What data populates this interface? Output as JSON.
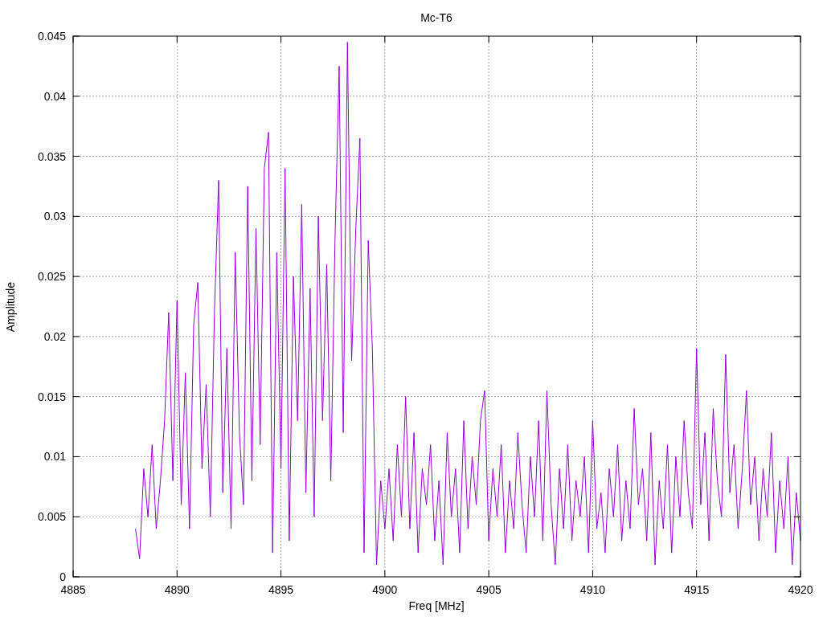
{
  "chart_data": {
    "type": "line",
    "title": "Mc-T6",
    "xlabel": "Freq [MHz]",
    "ylabel": "Amplitude",
    "xlim": [
      4885,
      4920
    ],
    "ylim": [
      0,
      0.045
    ],
    "grid": true,
    "xticks": [
      4885,
      4890,
      4895,
      4900,
      4905,
      4910,
      4915,
      4920
    ],
    "yticks": [
      0,
      0.005,
      0.01,
      0.015,
      0.02,
      0.025,
      0.03,
      0.035,
      0.04,
      0.045
    ],
    "x": [
      4888.0,
      4888.2,
      4888.4,
      4888.6,
      4888.8,
      4889.0,
      4889.2,
      4889.4,
      4889.6,
      4889.8,
      4890.0,
      4890.2,
      4890.4,
      4890.6,
      4890.8,
      4891.0,
      4891.2,
      4891.4,
      4891.6,
      4891.8,
      4892.0,
      4892.2,
      4892.4,
      4892.6,
      4892.8,
      4893.0,
      4893.2,
      4893.4,
      4893.6,
      4893.8,
      4894.0,
      4894.2,
      4894.4,
      4894.6,
      4894.8,
      4895.0,
      4895.2,
      4895.4,
      4895.6,
      4895.8,
      4896.0,
      4896.2,
      4896.4,
      4896.6,
      4896.8,
      4897.0,
      4897.2,
      4897.4,
      4897.6,
      4897.8,
      4898.0,
      4898.2,
      4898.4,
      4898.6,
      4898.8,
      4899.0,
      4899.2,
      4899.4,
      4899.6,
      4899.8,
      4900.0,
      4900.2,
      4900.4,
      4900.6,
      4900.8,
      4901.0,
      4901.2,
      4901.4,
      4901.6,
      4901.8,
      4902.0,
      4902.2,
      4902.4,
      4902.6,
      4902.8,
      4903.0,
      4903.2,
      4903.4,
      4903.6,
      4903.8,
      4904.0,
      4904.2,
      4904.4,
      4904.6,
      4904.8,
      4905.0,
      4905.2,
      4905.4,
      4905.6,
      4905.8,
      4906.0,
      4906.2,
      4906.4,
      4906.6,
      4906.8,
      4907.0,
      4907.2,
      4907.4,
      4907.6,
      4907.8,
      4908.0,
      4908.2,
      4908.4,
      4908.6,
      4908.8,
      4909.0,
      4909.2,
      4909.4,
      4909.6,
      4909.8,
      4910.0,
      4910.2,
      4910.4,
      4910.6,
      4910.8,
      4911.0,
      4911.2,
      4911.4,
      4911.6,
      4911.8,
      4912.0,
      4912.2,
      4912.4,
      4912.6,
      4912.8,
      4913.0,
      4913.2,
      4913.4,
      4913.6,
      4913.8,
      4914.0,
      4914.2,
      4914.4,
      4914.6,
      4914.8,
      4915.0,
      4915.2,
      4915.4,
      4915.6,
      4915.8,
      4916.0,
      4916.2,
      4916.4,
      4916.6,
      4916.8,
      4917.0,
      4917.2,
      4917.4,
      4917.6,
      4917.8,
      4918.0,
      4918.2,
      4918.4,
      4918.6,
      4918.8,
      4919.0,
      4919.2,
      4919.4,
      4919.6,
      4919.8,
      4920.0
    ],
    "series": [
      {
        "color": "#9400d3",
        "values": [
          0.004,
          0.0015,
          0.009,
          0.005,
          0.011,
          0.004,
          0.008,
          0.013,
          0.022,
          0.008,
          0.023,
          0.006,
          0.017,
          0.004,
          0.021,
          0.0245,
          0.009,
          0.016,
          0.005,
          0.022,
          0.033,
          0.007,
          0.019,
          0.004,
          0.027,
          0.012,
          0.006,
          0.0325,
          0.008,
          0.029,
          0.011,
          0.034,
          0.037,
          0.002,
          0.027,
          0.009,
          0.034,
          0.003,
          0.025,
          0.013,
          0.031,
          0.007,
          0.024,
          0.005,
          0.03,
          0.013,
          0.026,
          0.008,
          0.028,
          0.0425,
          0.012,
          0.0445,
          0.018,
          0.029,
          0.0365,
          0.002,
          0.028,
          0.019,
          0.001,
          0.008,
          0.004,
          0.009,
          0.003,
          0.011,
          0.005,
          0.015,
          0.004,
          0.012,
          0.002,
          0.009,
          0.006,
          0.011,
          0.003,
          0.008,
          0.001,
          0.012,
          0.005,
          0.009,
          0.002,
          0.013,
          0.004,
          0.01,
          0.006,
          0.013,
          0.0155,
          0.003,
          0.009,
          0.005,
          0.011,
          0.002,
          0.008,
          0.004,
          0.012,
          0.006,
          0.002,
          0.01,
          0.005,
          0.013,
          0.003,
          0.0155,
          0.006,
          0.001,
          0.009,
          0.004,
          0.011,
          0.003,
          0.008,
          0.005,
          0.01,
          0.002,
          0.013,
          0.004,
          0.007,
          0.002,
          0.009,
          0.005,
          0.011,
          0.003,
          0.008,
          0.004,
          0.014,
          0.006,
          0.009,
          0.003,
          0.012,
          0.001,
          0.008,
          0.004,
          0.011,
          0.002,
          0.01,
          0.005,
          0.013,
          0.007,
          0.004,
          0.019,
          0.006,
          0.012,
          0.003,
          0.014,
          0.008,
          0.005,
          0.0185,
          0.007,
          0.011,
          0.004,
          0.009,
          0.0155,
          0.006,
          0.01,
          0.003,
          0.009,
          0.005,
          0.012,
          0.002,
          0.008,
          0.004,
          0.01,
          0.001,
          0.007,
          0.003
        ]
      }
    ]
  }
}
